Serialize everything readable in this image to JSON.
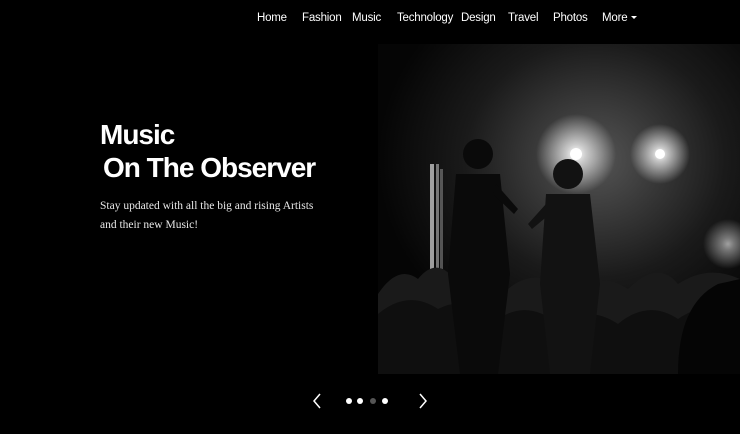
{
  "nav": {
    "items": [
      "Home",
      "Fashion",
      "Music",
      "Technology",
      "Design",
      "Travel",
      "Photos",
      "More"
    ]
  },
  "hero": {
    "title_line1": "Music",
    "title_line2": "On The Observer",
    "subtitle": "Stay updated with all the big and rising Artists and their new Music!"
  },
  "carousel": {
    "prev_icon": "chevron-left-icon",
    "next_icon": "chevron-right-icon",
    "slide_count": 4,
    "active_index": 0
  },
  "colors": {
    "background": "#000000",
    "text": "#ffffff"
  }
}
